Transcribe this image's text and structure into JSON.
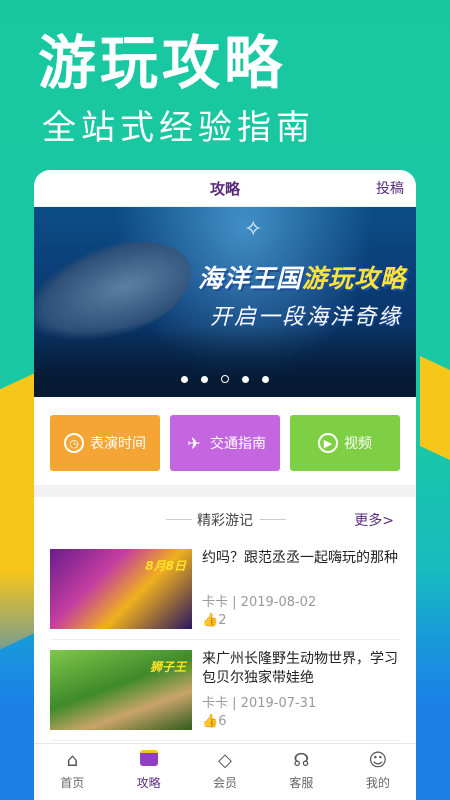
{
  "promo": {
    "title": "游玩攻略",
    "subtitle": "全站式经验指南"
  },
  "header": {
    "title": "攻略",
    "contribute": "投稿"
  },
  "banner": {
    "headline_prefix": "海洋王国",
    "headline_highlight": "游玩攻略",
    "subline": "开启一段海洋奇缘",
    "dots_count": 5,
    "active_dot": 3
  },
  "tiles": [
    {
      "label": "表演时间",
      "icon": "clock-icon",
      "color": "#f5a534"
    },
    {
      "label": "交通指南",
      "icon": "plane-icon",
      "color": "#c466e0"
    },
    {
      "label": "视频",
      "icon": "play-icon",
      "color": "#7fcf44"
    }
  ],
  "section": {
    "title": "精彩游记",
    "more": "更多>"
  },
  "articles": [
    {
      "title": "约吗？跟范丞丞一起嗨玩的那种",
      "author": "卡卡",
      "date": "2019-08-02",
      "likes": "2",
      "badge": "8月8日"
    },
    {
      "title": "来广州长隆野生动物世界，学习包贝尔独家带娃绝",
      "author": "卡卡",
      "date": "2019-07-31",
      "likes": "6",
      "badge": "狮子王"
    }
  ],
  "tabbar": [
    {
      "label": "首页",
      "icon": "home-icon"
    },
    {
      "label": "攻略",
      "icon": "guide-icon",
      "active": true
    },
    {
      "label": "会员",
      "icon": "diamond-icon"
    },
    {
      "label": "客服",
      "icon": "headset-icon"
    },
    {
      "label": "我的",
      "icon": "user-icon"
    }
  ]
}
